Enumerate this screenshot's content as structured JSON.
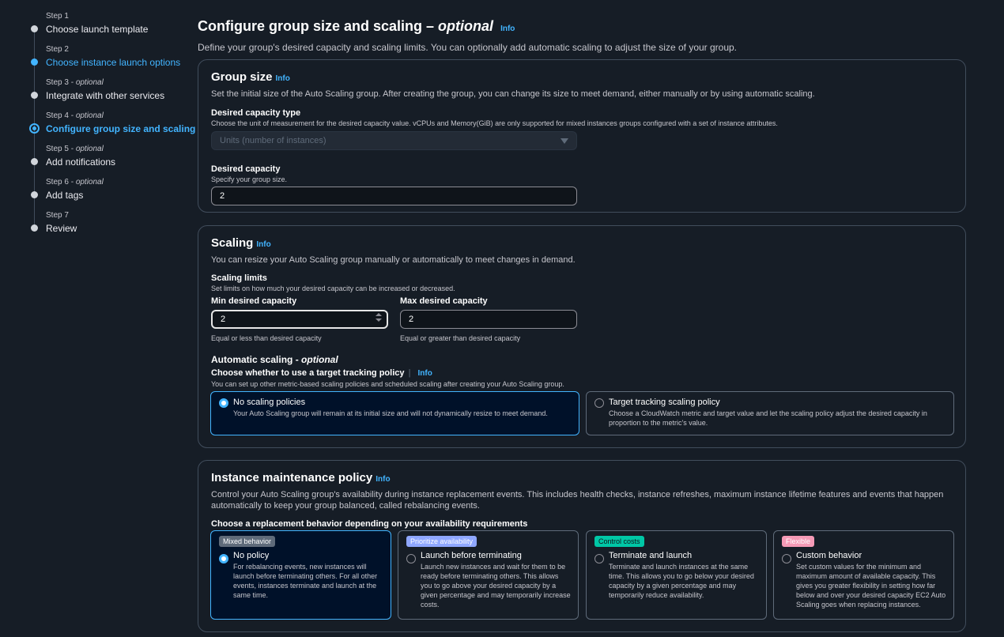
{
  "steps": [
    {
      "num": "Step 1",
      "optional": "",
      "title": "Choose launch template"
    },
    {
      "num": "Step 2",
      "optional": "",
      "title": "Choose instance launch options"
    },
    {
      "num": "Step 3 - ",
      "optional": "optional",
      "title": "Integrate with other services"
    },
    {
      "num": "Step 4 - ",
      "optional": "optional",
      "title": "Configure group size and scaling"
    },
    {
      "num": "Step 5 - ",
      "optional": "optional",
      "title": "Add notifications"
    },
    {
      "num": "Step 6 - ",
      "optional": "optional",
      "title": "Add tags"
    },
    {
      "num": "Step 7",
      "optional": "",
      "title": "Review"
    }
  ],
  "page": {
    "title": "Configure group size and scaling – ",
    "title_optional": "optional",
    "info": "Info",
    "description": "Define your group's desired capacity and scaling limits. You can optionally add automatic scaling to adjust the size of your group."
  },
  "group_size": {
    "heading": "Group size",
    "info": "Info",
    "description": "Set the initial size of the Auto Scaling group. After creating the group, you can change its size to meet demand, either manually or by using automatic scaling.",
    "capacity_type_label": "Desired capacity type",
    "capacity_type_desc": "Choose the unit of measurement for the desired capacity value. vCPUs and Memory(GiB) are only supported for mixed instances groups configured with a set of instance attributes.",
    "capacity_type_value": "Units (number of instances)",
    "desired_label": "Desired capacity",
    "desired_desc": "Specify your group size.",
    "desired_value": "2"
  },
  "scaling": {
    "heading": "Scaling",
    "info": "Info",
    "description": "You can resize your Auto Scaling group manually or automatically to meet changes in demand.",
    "limits_label": "Scaling limits",
    "limits_desc": "Set limits on how much your desired capacity can be increased or decreased.",
    "min_label": "Min desired capacity",
    "min_value": "2",
    "min_constraint": "Equal or less than desired capacity",
    "max_label": "Max desired capacity",
    "max_value": "2",
    "max_constraint": "Equal or greater than desired capacity",
    "auto_label": "Automatic scaling - ",
    "auto_optional": "optional",
    "policy_label": "Choose whether to use a target tracking policy",
    "policy_info": "Info",
    "policy_desc": "You can set up other metric-based scaling policies and scheduled scaling after creating your Auto Scaling group.",
    "options": [
      {
        "title": "No scaling policies",
        "desc": "Your Auto Scaling group will remain at its initial size and will not dynamically resize to meet demand."
      },
      {
        "title": "Target tracking scaling policy",
        "desc": "Choose a CloudWatch metric and target value and let the scaling policy adjust the desired capacity in proportion to the metric's value."
      }
    ]
  },
  "maintenance": {
    "heading": "Instance maintenance policy",
    "info": "Info",
    "description": "Control your Auto Scaling group's availability during instance replacement events. This includes health checks, instance refreshes, maximum instance lifetime features and events that happen automatically to keep your group balanced, called rebalancing events.",
    "choose_label": "Choose a replacement behavior depending on your availability requirements",
    "options": [
      {
        "badge": "Mixed behavior",
        "badge_color": "#5f6b7a",
        "title": "No policy",
        "desc": "For rebalancing events, new instances will launch before terminating others. For all other events, instances terminate and launch at the same time."
      },
      {
        "badge": "Prioritize availability",
        "badge_color": "#8fa7ff",
        "title": "Launch before terminating",
        "desc": "Launch new instances and wait for them to be ready before terminating others. This allows you to go above your desired capacity by a given percentage and may temporarily increase costs."
      },
      {
        "badge": "Control costs",
        "badge_color": "#00c7a6",
        "title": "Terminate and launch",
        "desc": "Terminate and launch instances at the same time. This allows you to go below your desired capacity by a given percentage and may temporarily reduce availability."
      },
      {
        "badge": "Flexible",
        "badge_color": "#f59ab6",
        "title": "Custom behavior",
        "desc": "Set custom values for the minimum and maximum amount of available capacity. This gives you greater flexibility in setting how far below and over your desired capacity EC2 Auto Scaling goes when replacing instances."
      }
    ]
  }
}
